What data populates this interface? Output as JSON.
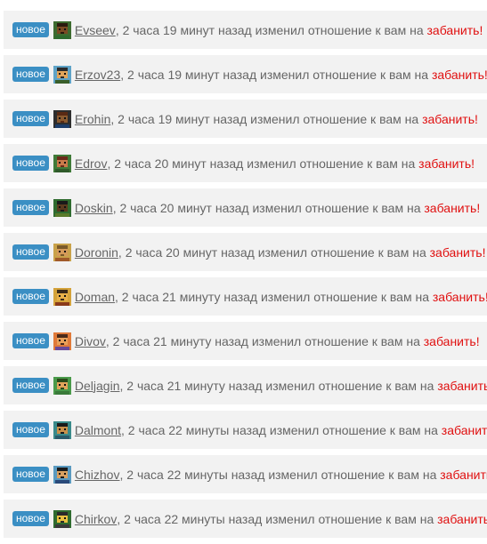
{
  "badge_label": "новое",
  "colors": {
    "badge_bg": "#3b8fc4",
    "text": "#666666",
    "ban": "#e01010",
    "row_bg": "#f2f2f2"
  },
  "feed": [
    {
      "user": "Evseev",
      "message": ", 2 часа 19 минут назад изменил отношение к вам на ",
      "status": "забанить!",
      "avatar": "pixel-avatar-icon",
      "bg": "#3d6b2f",
      "face": "#7a4a23",
      "hair": "#2b1a0e",
      "shirt": "#2f6b2f"
    },
    {
      "user": "Erzov23",
      "message": ", 2 часа 19 минут назад изменил отношение к вам на ",
      "status": "забанить!",
      "avatar": "pixel-avatar-icon",
      "bg": "#5fa3c7",
      "face": "#e0a45a",
      "hair": "#2a2a2a",
      "shirt": "#3a5f2a"
    },
    {
      "user": "Erohin",
      "message": ", 2 часа 19 минут назад изменил отношение к вам на ",
      "status": "забанить!",
      "avatar": "pixel-avatar-icon",
      "bg": "#2d2d2d",
      "face": "#8a5a30",
      "hair": "#5a2a14",
      "shirt": "#1c3d6b"
    },
    {
      "user": "Edrov",
      "message": ", 2 часа 20 минут назад изменил отношение к вам на ",
      "status": "забанить!",
      "avatar": "pixel-avatar-icon",
      "bg": "#3f7a38",
      "face": "#c87a4a",
      "hair": "#6b2a1a",
      "shirt": "#2f5a2a"
    },
    {
      "user": "Doskin",
      "message": ", 2 часа 20 минут назад изменил отношение к вам на ",
      "status": "забанить!",
      "avatar": "pixel-avatar-icon",
      "bg": "#2f6b2f",
      "face": "#5a3a1e",
      "hair": "#1a1a1a",
      "shirt": "#5a7a2a"
    },
    {
      "user": "Doronin",
      "message": ", 2 часа 20 минут назад изменил отношение к вам на ",
      "status": "забанить!",
      "avatar": "pixel-avatar-icon",
      "bg": "#c9a24a",
      "face": "#d49a5a",
      "hair": "#7a5a2a",
      "shirt": "#a05a2a"
    },
    {
      "user": "Doman",
      "message": ", 2 часа 21 минуту назад изменил отношение к вам на ",
      "status": "забанить!",
      "avatar": "pixel-avatar-icon",
      "bg": "#d4a23a",
      "face": "#e8b04a",
      "hair": "#3a2a1a",
      "shirt": "#8a3a1a"
    },
    {
      "user": "Divov",
      "message": ", 2 часа 21 минуту назад изменил отношение к вам на ",
      "status": "забанить!",
      "avatar": "pixel-avatar-icon",
      "bg": "#e07a3a",
      "face": "#e8a05a",
      "hair": "#4a2a1a",
      "shirt": "#6a4a9a"
    },
    {
      "user": "Deljagin",
      "message": ", 2 часа 21 минуту назад изменил отношение к вам на ",
      "status": "забанить!",
      "avatar": "pixel-avatar-icon",
      "bg": "#4a9a4a",
      "face": "#e0a45a",
      "hair": "#2a4a1a",
      "shirt": "#3a7a3a"
    },
    {
      "user": "Dalmont",
      "message": ", 2 часа 22 минуты назад изменил отношение к вам на ",
      "status": "забанить!",
      "avatar": "pixel-avatar-icon",
      "bg": "#3a8a8a",
      "face": "#c8904a",
      "hair": "#1a1a1a",
      "shirt": "#2a5a6a"
    },
    {
      "user": "Chizhov",
      "message": ", 2 часа 22 минуты назад изменил отношение к вам на ",
      "status": "забанить!",
      "avatar": "pixel-avatar-icon",
      "bg": "#5a9ac0",
      "face": "#d8a060",
      "hair": "#1a1a1a",
      "shirt": "#2a4a7a"
    },
    {
      "user": "Chirkov",
      "message": ", 2 часа 22 минуты назад изменил отношение к вам на ",
      "status": "забанить!",
      "avatar": "pixel-avatar-icon",
      "bg": "#2f6b2f",
      "face": "#e8c040",
      "hair": "#2a2a2a",
      "shirt": "#3a3a3a"
    }
  ]
}
